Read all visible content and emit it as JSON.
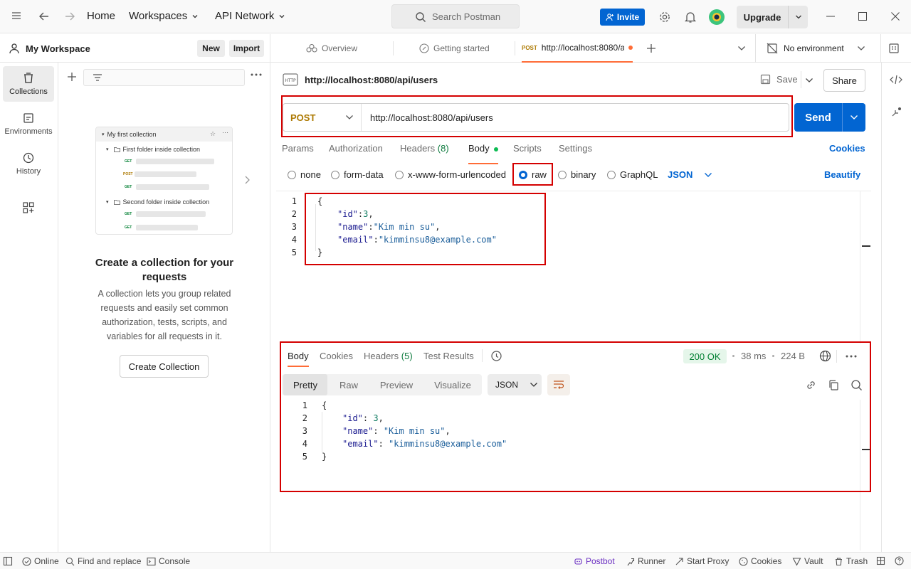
{
  "topbar": {
    "home": "Home",
    "workspaces": "Workspaces",
    "api_network": "API Network",
    "search_placeholder": "Search Postman",
    "invite": "Invite",
    "upgrade": "Upgrade"
  },
  "sidebar": {
    "workspace_name": "My Workspace",
    "new_label": "New",
    "import_label": "Import",
    "rail": [
      {
        "label": "Collections",
        "icon": "collections-icon"
      },
      {
        "label": "Environments",
        "icon": "environments-icon"
      },
      {
        "label": "History",
        "icon": "history-icon"
      }
    ],
    "preview": {
      "collection": "My first collection",
      "folder1": "First folder inside collection",
      "folder2": "Second folder inside collection",
      "get": "GET",
      "post": "POST"
    },
    "empty_title": "Create a collection for your requests",
    "empty_desc": "A collection lets you group related requests and easily set common authorization, tests, scripts, and variables for all requests in it.",
    "create_button": "Create Collection"
  },
  "tabs": {
    "overview": "Overview",
    "getting_started": "Getting started",
    "active_method": "POST",
    "active_url": "http://localhost:8080/a",
    "environment": "No environment"
  },
  "request": {
    "title": "http://localhost:8080/api/users",
    "save": "Save",
    "share": "Share",
    "method": "POST",
    "url": "http://localhost:8080/api/users",
    "send": "Send",
    "tabs": {
      "params": "Params",
      "authorization": "Authorization",
      "headers": "Headers",
      "headers_count": "(8)",
      "body": "Body",
      "scripts": "Scripts",
      "settings": "Settings"
    },
    "cookies": "Cookies",
    "body_types": {
      "none": "none",
      "form_data": "form-data",
      "urlencoded": "x-www-form-urlencoded",
      "raw": "raw",
      "binary": "binary",
      "graphql": "GraphQL"
    },
    "format": "JSON",
    "beautify": "Beautify",
    "body_lines": [
      {
        "n": "1",
        "text": "{"
      },
      {
        "n": "2",
        "key": "\"id\"",
        "sep": ":",
        "val": "3",
        "end": ","
      },
      {
        "n": "3",
        "key": "\"name\"",
        "sep": ":",
        "val": "\"Kim min su\"",
        "end": ","
      },
      {
        "n": "4",
        "key": "\"email\"",
        "sep": ":",
        "val": "\"kimminsu8@example.com\"",
        "end": ""
      },
      {
        "n": "5",
        "text": "}"
      }
    ]
  },
  "response": {
    "tabs": {
      "body": "Body",
      "cookies": "Cookies",
      "headers": "Headers",
      "headers_count": "(5)",
      "test_results": "Test Results"
    },
    "status": "200 OK",
    "time": "38 ms",
    "size": "224 B",
    "views": {
      "pretty": "Pretty",
      "raw": "Raw",
      "preview": "Preview",
      "visualize": "Visualize"
    },
    "format": "JSON",
    "body_lines": [
      {
        "n": "1",
        "text": "{"
      },
      {
        "n": "2",
        "key": "\"id\"",
        "sep": ": ",
        "val": "3",
        "end": ","
      },
      {
        "n": "3",
        "key": "\"name\"",
        "sep": ": ",
        "val": "\"Kim min su\"",
        "end": ","
      },
      {
        "n": "4",
        "key": "\"email\"",
        "sep": ": ",
        "val": "\"kimminsu8@example.com\"",
        "end": ""
      },
      {
        "n": "5",
        "text": "}"
      }
    ]
  },
  "footer": {
    "online": "Online",
    "find_replace": "Find and replace",
    "console": "Console",
    "postbot": "Postbot",
    "runner": "Runner",
    "start_proxy": "Start Proxy",
    "cookies": "Cookies",
    "vault": "Vault",
    "trash": "Trash"
  },
  "colors": {
    "accent": "#0265d2",
    "orange": "#ff6c37",
    "post": "#ad7a03",
    "success": "#007f31",
    "highlight_box": "#d40000"
  }
}
